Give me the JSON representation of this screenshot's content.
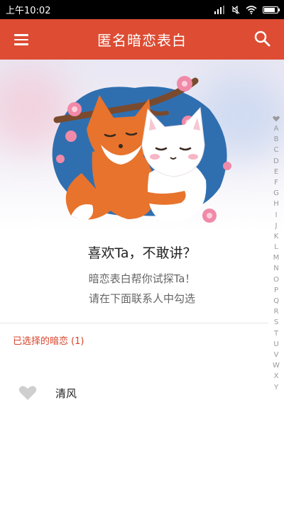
{
  "status_bar": {
    "time": "上午10:02"
  },
  "app_bar": {
    "title": "匿名暗恋表白",
    "menu_icon": "menu-icon",
    "search_icon": "search-icon",
    "color": "#dd4c33"
  },
  "hero": {
    "image": "fox-and-cat-hugging-illustration"
  },
  "intro": {
    "headline": "喜欢Ta，不敢讲？",
    "line1": "暗恋表白帮你试探Ta！",
    "line2": "请在下面联系人中勾选"
  },
  "selected": {
    "label": "已选择的暗恋",
    "count": "(1)",
    "contacts": [
      {
        "name": "清风",
        "icon": "heart-icon"
      }
    ]
  },
  "alphabet_index": {
    "icon": "heart-icon",
    "letters": [
      "A",
      "B",
      "C",
      "D",
      "E",
      "F",
      "G",
      "H",
      "I",
      "J",
      "K",
      "L",
      "M",
      "N",
      "O",
      "P",
      "Q",
      "R",
      "S",
      "T",
      "U",
      "V",
      "W",
      "X",
      "Y"
    ]
  }
}
